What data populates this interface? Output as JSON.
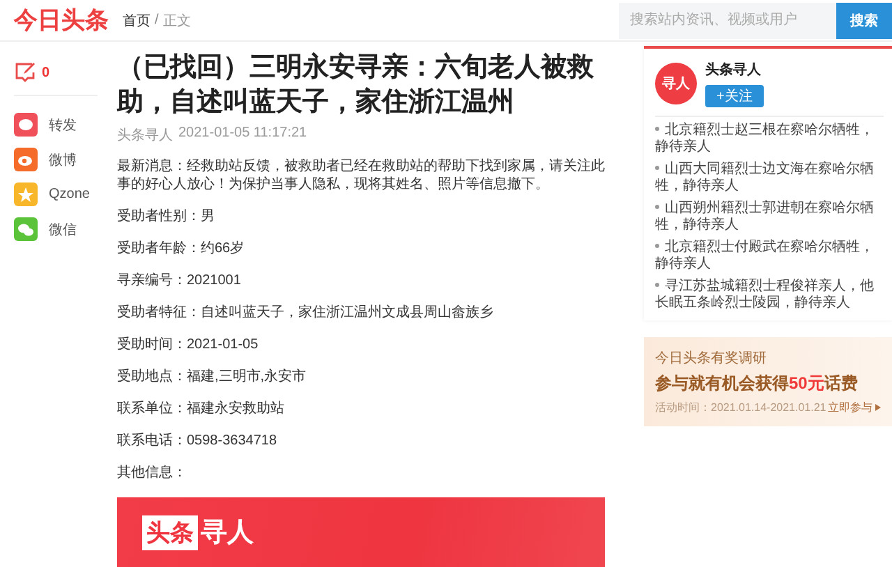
{
  "header": {
    "logo": "今日头条",
    "breadcrumb": [
      {
        "label": "首页",
        "link": true
      },
      {
        "label": "正文",
        "link": false
      }
    ],
    "separator": "/",
    "search": {
      "placeholder": "搜索站内资讯、视频或用户",
      "button": "搜索"
    }
  },
  "sidebar": {
    "comment_count": "0",
    "shares": [
      {
        "kind": "bubble",
        "label": "转发",
        "color": "#f0505a"
      },
      {
        "kind": "eye",
        "label": "微博",
        "color": "#f56b2a"
      },
      {
        "kind": "star",
        "label": "Qzone",
        "color": "#f8b62a"
      },
      {
        "kind": "chat",
        "label": "微信",
        "color": "#5bc33a"
      }
    ]
  },
  "article": {
    "title": "（已找回）三明永安寻亲：六旬老人被救助，自述叫蓝天子，家住浙江温州",
    "source": "头条寻人",
    "time": "2021-01-05 11:17:21",
    "paragraphs": [
      "最新消息：经救助站反馈，被救助者已经在救助站的帮助下找到家属，请关注此事的好心人放心！为保护当事人隐私，现将其姓名、照片等信息撤下。",
      "受助者性别：男",
      "受助者年龄：约66岁",
      "寻亲编号：2021001",
      "受助者特征：自述叫蓝天子，家住浙江温州文成县周山畲族乡",
      "受助时间：2021-01-05",
      "受助地点：福建,三明市,永安市",
      "联系单位：福建永安救助站",
      "联系电话：0598-3634718",
      "其他信息："
    ],
    "banner": {
      "boxed": "头条",
      "plain": "寻人"
    }
  },
  "author_card": {
    "avatar": "寻人",
    "name": "头条寻人",
    "follow": "+关注",
    "items": [
      "北京籍烈士赵三根在察哈尔牺牲，静待亲人",
      "山西大同籍烈士边文海在察哈尔牺牲，静待亲人",
      "山西朔州籍烈士郭进朝在察哈尔牺牲，静待亲人",
      "北京籍烈士付殿武在察哈尔牺牲，静待亲人",
      "寻江苏盐城籍烈士程俊祥亲人，他长眠五条岭烈士陵园，静待亲人"
    ]
  },
  "promo": {
    "title": "今日头条有奖调研",
    "headline": [
      {
        "text": "参与就有机会获得",
        "highlight": false
      },
      {
        "text": "50元",
        "highlight": true
      },
      {
        "text": "话费",
        "highlight": false
      }
    ],
    "period": "活动时间：2021.01.14-2021.01.21",
    "cta": "立即参与"
  }
}
